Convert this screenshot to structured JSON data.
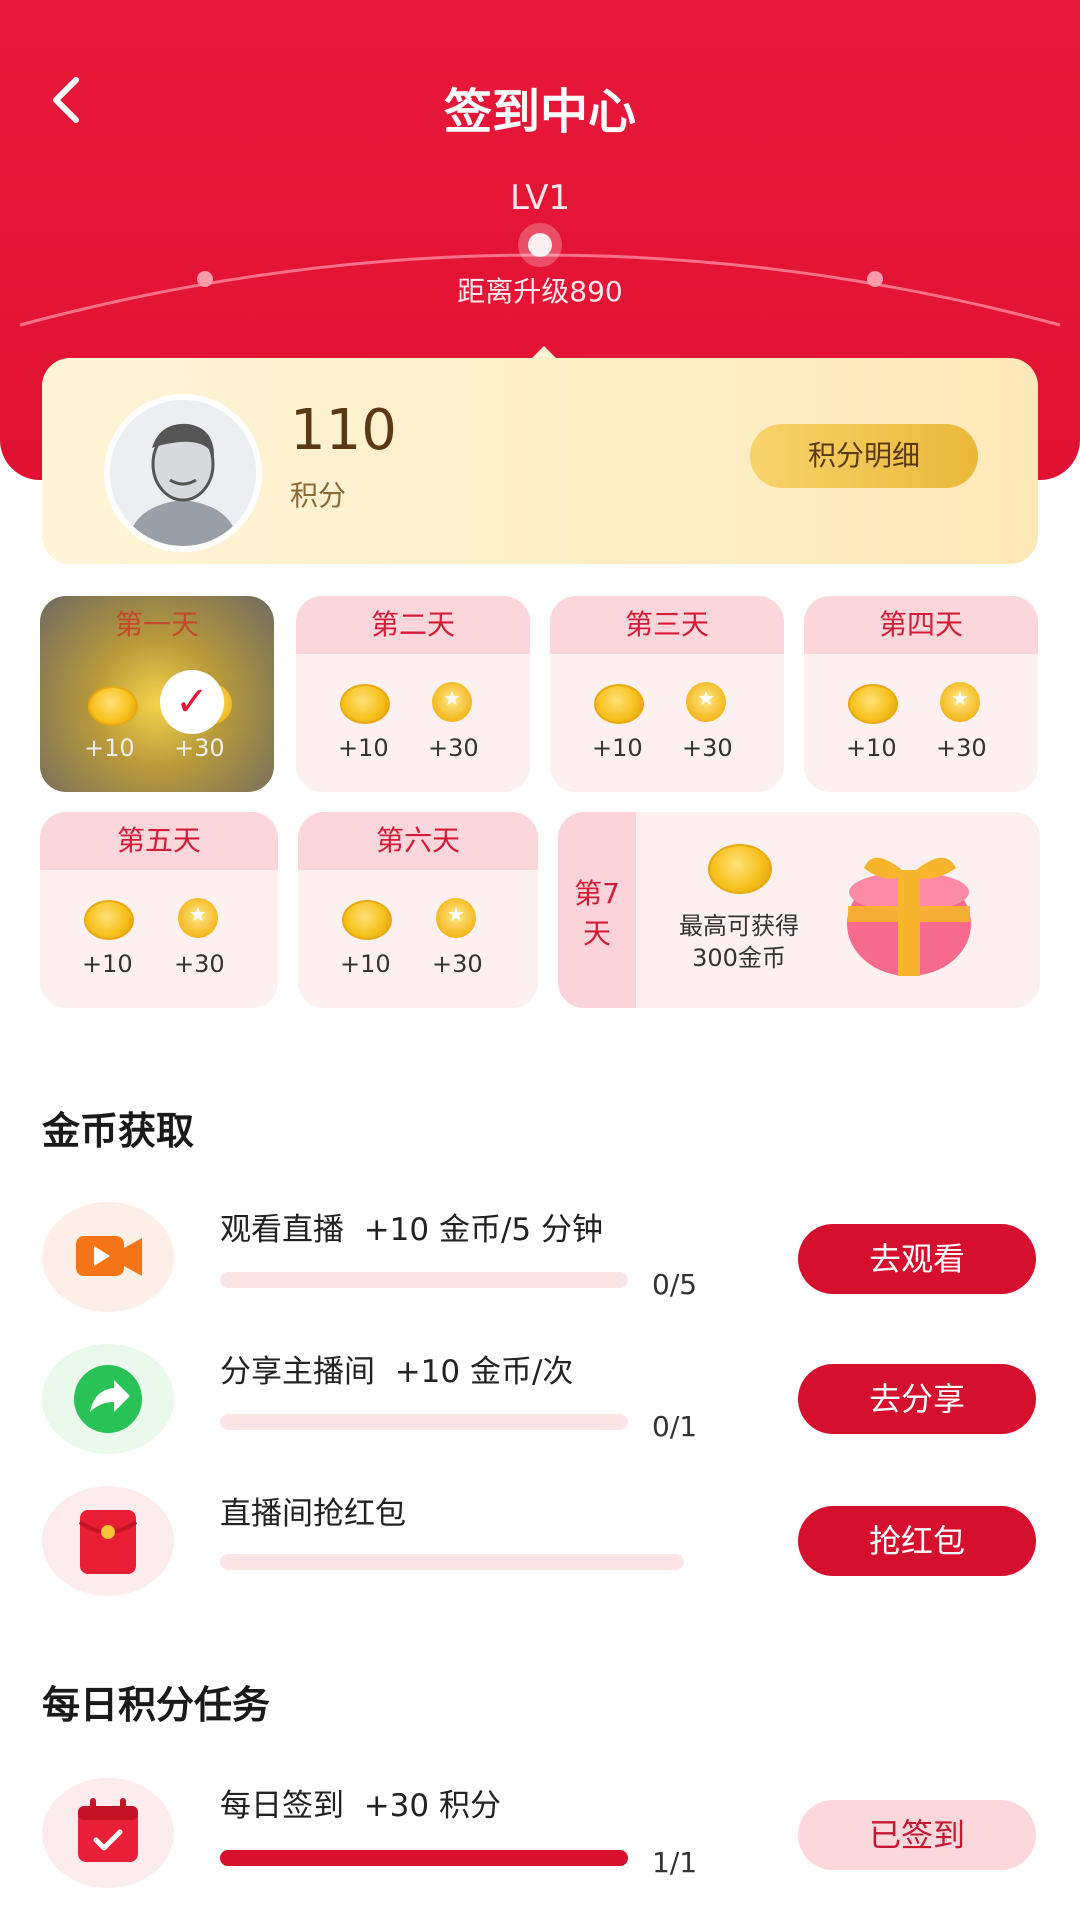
{
  "header": {
    "title": "签到中心",
    "level": "LV1",
    "upgrade_text": "距离升级890"
  },
  "points": {
    "value": "110",
    "unit": "积分",
    "detail_button": "积分明细"
  },
  "days": [
    {
      "label": "第一天",
      "coin": "+10",
      "points": "+30",
      "checked": true
    },
    {
      "label": "第二天",
      "coin": "+10",
      "points": "+30"
    },
    {
      "label": "第三天",
      "coin": "+10",
      "points": "+30"
    },
    {
      "label": "第四天",
      "coin": "+10",
      "points": "+30"
    },
    {
      "label": "第五天",
      "coin": "+10",
      "points": "+30"
    },
    {
      "label": "第六天",
      "coin": "+10",
      "points": "+30"
    }
  ],
  "day7": {
    "label_line1": "第7",
    "label_line2": "天",
    "reward_line1": "最高可获得",
    "reward_line2": "300金币"
  },
  "coin_section": {
    "title": "金币获取",
    "tasks": [
      {
        "name": "观看直播  +10 金币/5 分钟",
        "count": "0/5",
        "progress": 0,
        "button": "去观看",
        "icon": "video-icon"
      },
      {
        "name": "分享主播间  +10 金币/次",
        "count": "0/1",
        "progress": 0,
        "button": "去分享",
        "icon": "share-icon"
      },
      {
        "name": "直播间抢红包",
        "count": "",
        "progress": 0,
        "button": "抢红包",
        "icon": "red-envelope-icon"
      }
    ]
  },
  "daily_section": {
    "title": "每日积分任务",
    "tasks": [
      {
        "name": "每日签到  +30 积分",
        "count": "1/1",
        "progress": 1,
        "button": "已签到",
        "icon": "calendar-check-icon"
      }
    ]
  },
  "colors": {
    "brand_red": "#e01131",
    "gold": "#f7c21f"
  }
}
